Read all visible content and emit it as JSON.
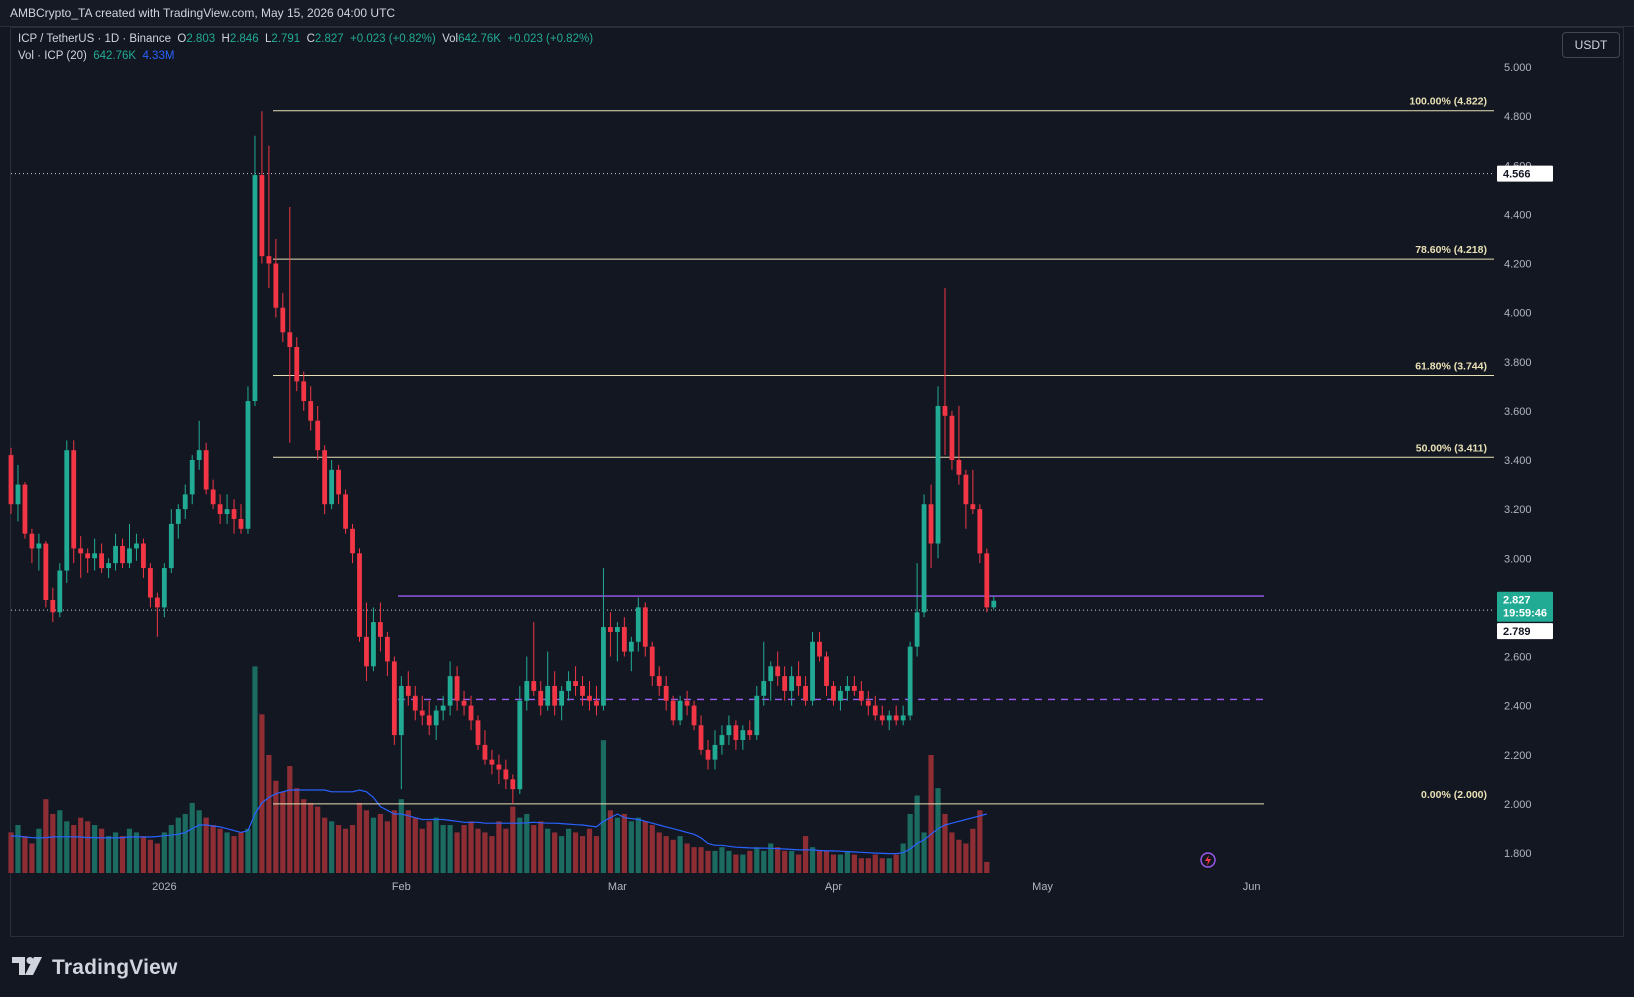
{
  "attribution": "AMBCrypto_TA created with TradingView.com, May 15, 2026 04:00 UTC",
  "legend": {
    "symbol": "ICP / TetherUS · 1D · Binance",
    "o_label": "O",
    "o_value": "2.803",
    "h_label": "H",
    "h_value": "2.846",
    "l_label": "L",
    "l_value": "2.791",
    "c_label": "C",
    "c_value": "2.827",
    "change": "+0.023 (+0.82%)",
    "vol_label": "Vol",
    "vol_value": "642.76K",
    "vol_change": "+0.023 (+0.82%)",
    "vol_indicator": "Vol · ICP (20)",
    "vol_now": "642.76K",
    "vol_ma": "4.33M"
  },
  "currency_button": "USDT",
  "brand": {
    "name": "TradingView",
    "logo_icon": "tradingview-logo-icon"
  },
  "colors": {
    "background": "#131722",
    "up": "#22ab94",
    "down": "#f23645",
    "up_volume": "#1b6b61",
    "down_volume": "#8e2e34",
    "vol_ma": "#2962ff",
    "fib": "#e8e0b5",
    "purple": "#9c5cf0"
  },
  "chart_data": {
    "type": "candlestick",
    "symbol": "ICP/USDT",
    "timeframe": "1D",
    "ylim": [
      1.72,
      5.1
    ],
    "y_ticks": [
      "5.000",
      "4.800",
      "4.600",
      "4.400",
      "4.200",
      "4.000",
      "3.800",
      "3.600",
      "3.400",
      "3.200",
      "3.000",
      "2.800",
      "2.600",
      "2.400",
      "2.200",
      "2.000",
      "1.800"
    ],
    "x_ticks": [
      "2026",
      "Feb",
      "Mar",
      "Apr",
      "May",
      "Jun"
    ],
    "price_labels": {
      "dotted_high": "4.566",
      "last_price": "2.827",
      "countdown": "19:59:46",
      "dotted_low": "2.789"
    },
    "fib_levels": [
      {
        "label": "100.00% (4.822)",
        "value": 4.822
      },
      {
        "label": "78.60% (4.218)",
        "value": 4.218
      },
      {
        "label": "61.80% (3.744)",
        "value": 3.744
      },
      {
        "label": "50.00% (3.411)",
        "value": 3.411
      },
      {
        "label": "0.00% (2.000)",
        "value": 2.0
      }
    ],
    "resistance_line": 2.846,
    "dashed_support": 2.425,
    "candles": [
      [
        3.42,
        3.45,
        3.18,
        3.22
      ],
      [
        3.22,
        3.38,
        3.15,
        3.3
      ],
      [
        3.3,
        3.31,
        3.08,
        3.1
      ],
      [
        3.1,
        3.12,
        2.98,
        3.04
      ],
      [
        3.04,
        3.1,
        2.95,
        3.06
      ],
      [
        3.06,
        3.07,
        2.8,
        2.83
      ],
      [
        2.83,
        2.88,
        2.74,
        2.78
      ],
      [
        2.78,
        2.98,
        2.76,
        2.95
      ],
      [
        2.95,
        3.48,
        2.9,
        3.44
      ],
      [
        3.44,
        3.48,
        2.98,
        3.04
      ],
      [
        3.04,
        3.09,
        2.92,
        3.02
      ],
      [
        3.02,
        3.04,
        2.94,
        3.0
      ],
      [
        3.0,
        3.08,
        2.95,
        3.02
      ],
      [
        3.02,
        3.06,
        2.94,
        2.96
      ],
      [
        2.96,
        3.0,
        2.92,
        2.98
      ],
      [
        2.98,
        3.1,
        2.95,
        3.05
      ],
      [
        3.05,
        3.08,
        2.96,
        2.98
      ],
      [
        2.98,
        3.14,
        2.96,
        3.04
      ],
      [
        3.04,
        3.1,
        2.99,
        3.06
      ],
      [
        3.06,
        3.08,
        2.92,
        2.96
      ],
      [
        2.96,
        2.98,
        2.8,
        2.84
      ],
      [
        2.84,
        2.86,
        2.68,
        2.8
      ],
      [
        2.8,
        2.98,
        2.76,
        2.96
      ],
      [
        2.96,
        3.2,
        2.94,
        3.14
      ],
      [
        3.14,
        3.22,
        3.08,
        3.2
      ],
      [
        3.2,
        3.3,
        3.16,
        3.26
      ],
      [
        3.26,
        3.42,
        3.22,
        3.4
      ],
      [
        3.4,
        3.56,
        3.36,
        3.44
      ],
      [
        3.44,
        3.47,
        3.26,
        3.28
      ],
      [
        3.28,
        3.32,
        3.2,
        3.22
      ],
      [
        3.22,
        3.26,
        3.14,
        3.18
      ],
      [
        3.18,
        3.26,
        3.14,
        3.2
      ],
      [
        3.2,
        3.24,
        3.1,
        3.16
      ],
      [
        3.16,
        3.22,
        3.1,
        3.12
      ],
      [
        3.12,
        3.7,
        3.1,
        3.64
      ],
      [
        3.64,
        4.72,
        3.62,
        4.56
      ],
      [
        4.56,
        4.82,
        4.2,
        4.23
      ],
      [
        4.23,
        4.68,
        4.1,
        4.2
      ],
      [
        4.2,
        4.3,
        3.98,
        4.02
      ],
      [
        4.02,
        4.08,
        3.88,
        3.92
      ],
      [
        3.92,
        4.43,
        3.47,
        3.86
      ],
      [
        3.86,
        3.9,
        3.68,
        3.72
      ],
      [
        3.72,
        3.76,
        3.6,
        3.64
      ],
      [
        3.64,
        3.7,
        3.52,
        3.56
      ],
      [
        3.56,
        3.62,
        3.4,
        3.44
      ],
      [
        3.44,
        3.46,
        3.18,
        3.22
      ],
      [
        3.22,
        3.4,
        3.2,
        3.36
      ],
      [
        3.36,
        3.38,
        3.22,
        3.26
      ],
      [
        3.26,
        3.28,
        3.1,
        3.12
      ],
      [
        3.12,
        3.14,
        2.98,
        3.02
      ],
      [
        3.02,
        3.04,
        2.66,
        2.68
      ],
      [
        2.68,
        2.82,
        2.5,
        2.56
      ],
      [
        2.56,
        2.8,
        2.54,
        2.74
      ],
      [
        2.74,
        2.82,
        2.62,
        2.68
      ],
      [
        2.68,
        2.7,
        2.52,
        2.58
      ],
      [
        2.58,
        2.6,
        2.24,
        2.28
      ],
      [
        2.28,
        2.52,
        2.06,
        2.48
      ],
      [
        2.48,
        2.54,
        2.4,
        2.44
      ],
      [
        2.44,
        2.48,
        2.34,
        2.38
      ],
      [
        2.38,
        2.44,
        2.32,
        2.36
      ],
      [
        2.36,
        2.42,
        2.28,
        2.32
      ],
      [
        2.32,
        2.4,
        2.26,
        2.38
      ],
      [
        2.38,
        2.44,
        2.34,
        2.4
      ],
      [
        2.4,
        2.58,
        2.36,
        2.52
      ],
      [
        2.52,
        2.56,
        2.38,
        2.42
      ],
      [
        2.42,
        2.46,
        2.36,
        2.4
      ],
      [
        2.4,
        2.44,
        2.3,
        2.34
      ],
      [
        2.34,
        2.36,
        2.22,
        2.24
      ],
      [
        2.24,
        2.3,
        2.16,
        2.18
      ],
      [
        2.18,
        2.22,
        2.12,
        2.16
      ],
      [
        2.16,
        2.2,
        2.08,
        2.14
      ],
      [
        2.14,
        2.18,
        2.06,
        2.1
      ],
      [
        2.1,
        2.12,
        2.0,
        2.06
      ],
      [
        2.06,
        2.48,
        2.04,
        2.42
      ],
      [
        2.42,
        2.6,
        2.38,
        2.5
      ],
      [
        2.5,
        2.74,
        2.44,
        2.46
      ],
      [
        2.46,
        2.5,
        2.36,
        2.4
      ],
      [
        2.4,
        2.62,
        2.38,
        2.48
      ],
      [
        2.48,
        2.54,
        2.36,
        2.4
      ],
      [
        2.4,
        2.48,
        2.34,
        2.46
      ],
      [
        2.46,
        2.54,
        2.42,
        2.5
      ],
      [
        2.5,
        2.56,
        2.44,
        2.48
      ],
      [
        2.48,
        2.52,
        2.4,
        2.44
      ],
      [
        2.44,
        2.5,
        2.38,
        2.42
      ],
      [
        2.42,
        2.48,
        2.36,
        2.4
      ],
      [
        2.4,
        2.96,
        2.38,
        2.72
      ],
      [
        2.72,
        2.78,
        2.6,
        2.7
      ],
      [
        2.7,
        2.74,
        2.58,
        2.72
      ],
      [
        2.72,
        2.76,
        2.6,
        2.62
      ],
      [
        2.62,
        2.68,
        2.54,
        2.66
      ],
      [
        2.66,
        2.84,
        2.62,
        2.8
      ],
      [
        2.8,
        2.82,
        2.6,
        2.64
      ],
      [
        2.64,
        2.66,
        2.48,
        2.52
      ],
      [
        2.52,
        2.56,
        2.44,
        2.48
      ],
      [
        2.48,
        2.52,
        2.38,
        2.42
      ],
      [
        2.42,
        2.44,
        2.32,
        2.34
      ],
      [
        2.34,
        2.44,
        2.32,
        2.42
      ],
      [
        2.42,
        2.46,
        2.36,
        2.4
      ],
      [
        2.4,
        2.42,
        2.3,
        2.32
      ],
      [
        2.32,
        2.36,
        2.2,
        2.22
      ],
      [
        2.22,
        2.26,
        2.14,
        2.18
      ],
      [
        2.18,
        2.3,
        2.14,
        2.24
      ],
      [
        2.24,
        2.32,
        2.2,
        2.28
      ],
      [
        2.28,
        2.36,
        2.24,
        2.32
      ],
      [
        2.32,
        2.34,
        2.22,
        2.26
      ],
      [
        2.26,
        2.32,
        2.22,
        2.3
      ],
      [
        2.3,
        2.34,
        2.26,
        2.28
      ],
      [
        2.28,
        2.48,
        2.26,
        2.44
      ],
      [
        2.44,
        2.66,
        2.4,
        2.5
      ],
      [
        2.5,
        2.58,
        2.42,
        2.56
      ],
      [
        2.56,
        2.62,
        2.48,
        2.52
      ],
      [
        2.52,
        2.56,
        2.42,
        2.46
      ],
      [
        2.46,
        2.56,
        2.4,
        2.52
      ],
      [
        2.52,
        2.58,
        2.44,
        2.48
      ],
      [
        2.48,
        2.52,
        2.4,
        2.42
      ],
      [
        2.42,
        2.7,
        2.4,
        2.66
      ],
      [
        2.66,
        2.7,
        2.58,
        2.6
      ],
      [
        2.6,
        2.62,
        2.44,
        2.48
      ],
      [
        2.48,
        2.5,
        2.4,
        2.42
      ],
      [
        2.42,
        2.48,
        2.38,
        2.46
      ],
      [
        2.46,
        2.52,
        2.42,
        2.48
      ],
      [
        2.48,
        2.52,
        2.44,
        2.46
      ],
      [
        2.46,
        2.5,
        2.4,
        2.42
      ],
      [
        2.42,
        2.46,
        2.36,
        2.4
      ],
      [
        2.4,
        2.44,
        2.34,
        2.36
      ],
      [
        2.36,
        2.4,
        2.32,
        2.34
      ],
      [
        2.34,
        2.38,
        2.3,
        2.36
      ],
      [
        2.36,
        2.4,
        2.32,
        2.34
      ],
      [
        2.34,
        2.4,
        2.32,
        2.36
      ],
      [
        2.36,
        2.66,
        2.34,
        2.64
      ],
      [
        2.64,
        2.98,
        2.6,
        2.78
      ],
      [
        2.78,
        3.26,
        2.76,
        3.22
      ],
      [
        3.22,
        3.3,
        2.96,
        3.06
      ],
      [
        3.06,
        3.7,
        3.0,
        3.62
      ],
      [
        3.62,
        4.1,
        3.42,
        3.58
      ],
      [
        3.58,
        3.6,
        3.36,
        3.4
      ],
      [
        3.4,
        3.62,
        3.3,
        3.34
      ],
      [
        3.34,
        3.36,
        3.12,
        3.22
      ],
      [
        3.22,
        3.36,
        3.18,
        3.2
      ],
      [
        3.2,
        3.22,
        2.98,
        3.02
      ],
      [
        3.02,
        3.04,
        2.78,
        2.8
      ],
      [
        2.8,
        2.846,
        2.791,
        2.827
      ]
    ],
    "volume_millions": [
      2.2,
      2.6,
      2.0,
      1.6,
      2.4,
      4.0,
      3.2,
      3.4,
      2.8,
      2.6,
      3.0,
      2.8,
      2.6,
      2.4,
      2.0,
      2.2,
      2.0,
      2.4,
      2.2,
      2.0,
      1.8,
      1.6,
      2.2,
      2.6,
      3.0,
      3.2,
      3.8,
      3.4,
      3.0,
      2.6,
      2.4,
      2.2,
      2.0,
      2.2,
      2.4,
      11.2,
      8.6,
      6.4,
      5.0,
      4.4,
      5.8,
      4.6,
      4.0,
      3.8,
      3.6,
      3.0,
      2.8,
      2.6,
      2.4,
      2.6,
      3.8,
      3.4,
      3.0,
      3.2,
      2.8,
      3.4,
      4.0,
      3.4,
      3.0,
      2.4,
      2.8,
      3.0,
      2.6,
      2.6,
      2.2,
      2.6,
      2.8,
      2.4,
      2.2,
      2.0,
      2.8,
      2.4,
      3.6,
      3.0,
      3.2,
      2.6,
      2.8,
      2.4,
      2.2,
      2.0,
      2.4,
      2.2,
      2.0,
      2.4,
      2.0,
      7.2,
      3.4,
      3.0,
      3.2,
      2.8,
      3.0,
      2.8,
      2.6,
      2.2,
      2.0,
      1.8,
      2.0,
      1.6,
      1.4,
      1.4,
      1.2,
      1.2,
      1.4,
      1.2,
      1.0,
      1.0,
      1.2,
      1.4,
      1.2,
      1.6,
      1.4,
      1.2,
      1.2,
      1.0,
      2.0,
      1.4,
      1.2,
      1.2,
      1.0,
      1.0,
      1.2,
      1.0,
      0.8,
      0.8,
      1.0,
      0.8,
      0.8,
      1.0,
      1.6,
      3.2,
      4.2,
      2.2,
      6.4,
      4.6,
      3.2,
      2.2,
      1.8,
      1.6,
      2.4,
      3.4,
      0.6
    ],
    "vol_ma20_millions": [
      2.0,
      2.0,
      1.95,
      1.92,
      1.9,
      1.92,
      1.95,
      1.96,
      1.96,
      1.96,
      1.95,
      1.92,
      1.92,
      1.9,
      1.9,
      1.9,
      1.92,
      1.95,
      1.96,
      1.95,
      1.95,
      1.98,
      2.02,
      2.05,
      2.1,
      2.2,
      2.4,
      2.6,
      2.6,
      2.55,
      2.5,
      2.4,
      2.3,
      2.2,
      2.3,
      3.2,
      3.8,
      4.1,
      4.3,
      4.4,
      4.5,
      4.5,
      4.5,
      4.5,
      4.5,
      4.5,
      4.4,
      4.4,
      4.4,
      4.4,
      4.5,
      4.4,
      4.1,
      3.6,
      3.4,
      3.2,
      3.2,
      3.1,
      3.0,
      2.9,
      2.9,
      2.9,
      2.9,
      2.85,
      2.8,
      2.75,
      2.75,
      2.75,
      2.7,
      2.7,
      2.7,
      2.7,
      2.7,
      2.7,
      2.72,
      2.75,
      2.72,
      2.7,
      2.7,
      2.68,
      2.65,
      2.62,
      2.6,
      2.55,
      2.5,
      2.8,
      3.0,
      3.2,
      3.0,
      2.95,
      2.9,
      2.8,
      2.7,
      2.6,
      2.5,
      2.4,
      2.3,
      2.2,
      2.1,
      1.9,
      1.6,
      1.5,
      1.5,
      1.45,
      1.4,
      1.38,
      1.36,
      1.35,
      1.35,
      1.34,
      1.32,
      1.3,
      1.28,
      1.25,
      1.25,
      1.25,
      1.22,
      1.2,
      1.2,
      1.18,
      1.16,
      1.14,
      1.12,
      1.1,
      1.08,
      1.06,
      1.05,
      1.05,
      1.1,
      1.3,
      1.6,
      1.8,
      2.1,
      2.4,
      2.6,
      2.7,
      2.8,
      2.9,
      3.0,
      3.1,
      3.2
    ]
  }
}
